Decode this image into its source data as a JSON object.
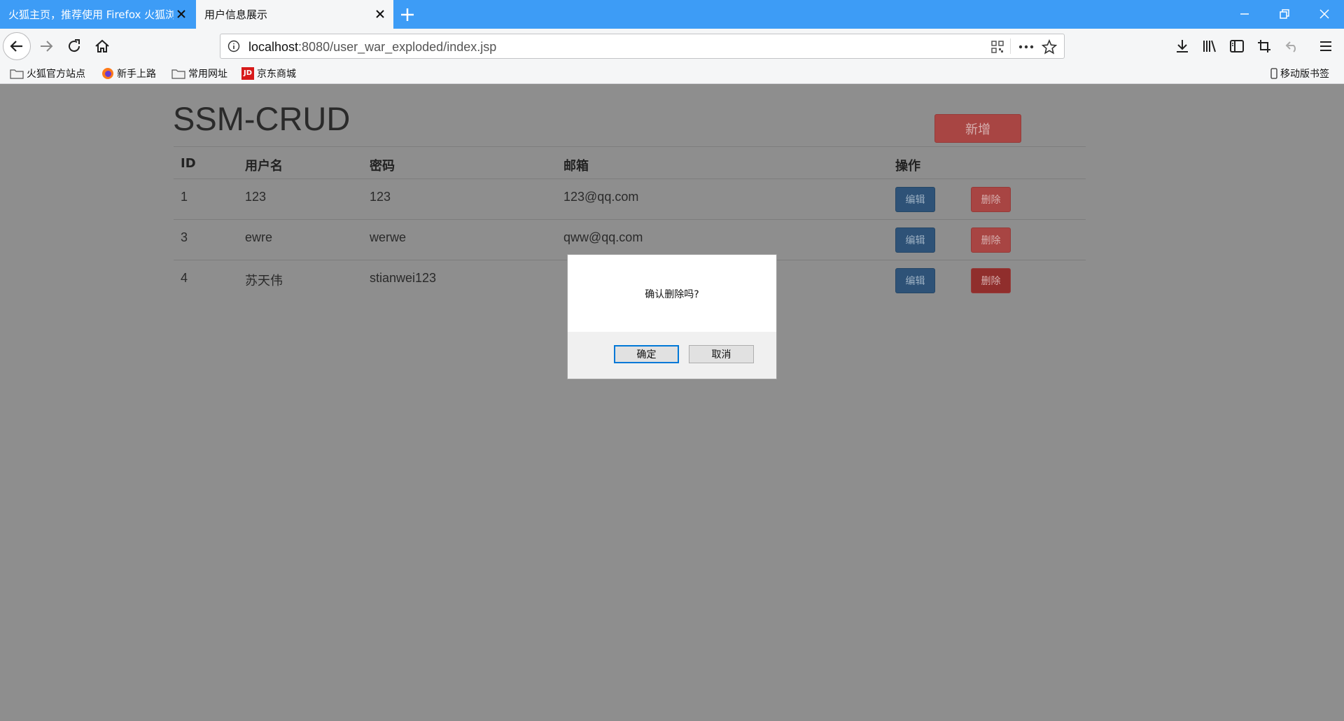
{
  "browser": {
    "tabs": [
      {
        "title": "火狐主页，推荐使用 Firefox 火狐浏览器",
        "active": false
      },
      {
        "title": "用户信息展示",
        "active": true
      }
    ],
    "url_host": "localhost",
    "url_path": ":8080/user_war_exploded/index.jsp",
    "bookmarks": [
      "火狐官方站点",
      "新手上路",
      "常用网址",
      "京东商城"
    ],
    "mobile_bookmarks": "移动版书签",
    "jd_logo_text": "JD",
    "accent_color": "#3d9cf6"
  },
  "page": {
    "title": "SSM-CRUD",
    "add_button": "新增",
    "table": {
      "headers": [
        "ID",
        "用户名",
        "密码",
        "邮箱",
        "操作"
      ],
      "rows": [
        {
          "id": "1",
          "username": "123",
          "password": "123",
          "email": "123@qq.com"
        },
        {
          "id": "3",
          "username": "ewre",
          "password": "werwe",
          "email": "qww@qq.com"
        },
        {
          "id": "4",
          "username": "苏天伟",
          "password": "stianwei123",
          "email": ""
        }
      ],
      "edit_label": "编辑",
      "delete_label": "删除"
    }
  },
  "dialog": {
    "message": "确认删除吗?",
    "ok_label": "确定",
    "cancel_label": "取消"
  }
}
